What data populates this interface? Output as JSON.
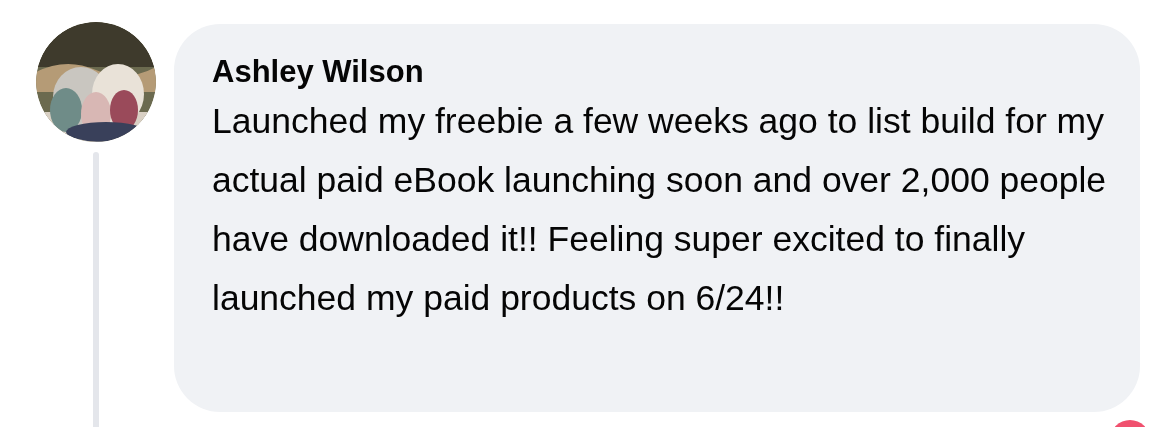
{
  "comment": {
    "author": "Ashley Wilson",
    "text": "Launched my freebie a few weeks ago to list build for my actual paid eBook launching soon and over 2,000 people have downloaded it!! Feeling super excited to finally launched my paid products on 6/24!!"
  }
}
